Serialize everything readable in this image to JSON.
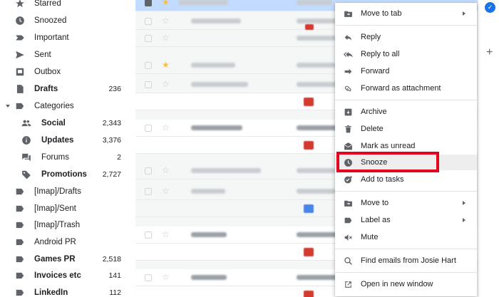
{
  "sidebar": {
    "items": [
      {
        "label": "Starred",
        "count": "",
        "icon": "star-icon",
        "bold": false
      },
      {
        "label": "Snoozed",
        "count": "",
        "icon": "clock-icon",
        "bold": false
      },
      {
        "label": "Important",
        "count": "",
        "icon": "important-icon",
        "bold": false
      },
      {
        "label": "Sent",
        "count": "",
        "icon": "send-icon",
        "bold": false
      },
      {
        "label": "Outbox",
        "count": "",
        "icon": "outbox-icon",
        "bold": false
      },
      {
        "label": "Drafts",
        "count": "236",
        "icon": "draft-icon",
        "bold": true
      },
      {
        "label": "Categories",
        "count": "",
        "icon": "label-icon",
        "bold": false
      },
      {
        "label": "Social",
        "count": "2,343",
        "icon": "people-icon",
        "bold": true
      },
      {
        "label": "Updates",
        "count": "3,376",
        "icon": "info-icon",
        "bold": true
      },
      {
        "label": "Forums",
        "count": "2",
        "icon": "forum-icon",
        "bold": false
      },
      {
        "label": "Promotions",
        "count": "2,727",
        "icon": "tag-icon",
        "bold": true
      },
      {
        "label": "[Imap]/Drafts",
        "count": "",
        "icon": "label-icon",
        "bold": false
      },
      {
        "label": "[Imap]/Sent",
        "count": "",
        "icon": "label-icon",
        "bold": false
      },
      {
        "label": "[Imap]/Trash",
        "count": "",
        "icon": "label-icon",
        "bold": false
      },
      {
        "label": "Android PR",
        "count": "",
        "icon": "label-icon",
        "bold": false
      },
      {
        "label": "Games PR",
        "count": "2,518",
        "icon": "label-icon",
        "bold": true
      },
      {
        "label": "Invoices etc",
        "count": "141",
        "icon": "label-icon",
        "bold": true
      },
      {
        "label": "LinkedIn",
        "count": "112",
        "icon": "label-icon",
        "bold": true
      }
    ]
  },
  "menu": {
    "move_to_tab": "Move to tab",
    "reply": "Reply",
    "reply_all": "Reply to all",
    "forward": "Forward",
    "forward_attachment": "Forward as attachment",
    "archive": "Archive",
    "delete": "Delete",
    "mark_unread": "Mark as unread",
    "snooze": "Snooze",
    "add_tasks": "Add to tasks",
    "move_to": "Move to",
    "label_as": "Label as",
    "mute": "Mute",
    "find_emails": "Find emails from Josie Hart",
    "open_window": "Open in new window"
  },
  "colors": {
    "highlight_box": "#e5001b",
    "selected_row": "#c2dbff",
    "accent": "#1a73e8"
  }
}
